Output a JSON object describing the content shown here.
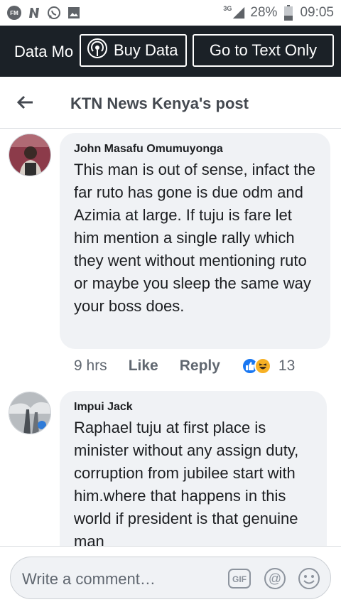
{
  "status_bar": {
    "network": "3G",
    "battery": "28%",
    "time": "09:05",
    "icons": [
      "fm-radio-icon",
      "n-app-icon",
      "whatsapp-icon",
      "gallery-icon",
      "signal-icon",
      "battery-icon"
    ]
  },
  "data_banner": {
    "mode_label": "Data Mo",
    "buy_label": "Buy Data",
    "text_only_label": "Go to Text Only"
  },
  "header": {
    "title": "KTN News Kenya's post"
  },
  "comments": [
    {
      "author": "John Masafu Omumuyonga",
      "text": "This man is out of sense, infact the far ruto has gone is due odm and Azimia at large. If tuju is fare let him mention a single rally which they went without mentioning ruto or maybe you sleep the same way your boss does.",
      "time": "9 hrs",
      "like_label": "Like",
      "reply_label": "Reply",
      "reactions": [
        "like",
        "haha"
      ],
      "reaction_count": "13"
    },
    {
      "author": "Impui Jack",
      "text": "Raphael tuju at first place is minister without any assign duty, corruption from jubilee start with him.where that happens in this world if president is that genuine man"
    }
  ],
  "comment_box": {
    "placeholder": "Write a comment…",
    "gif_label": "GIF"
  },
  "colors": {
    "banner_bg": "#1b2127",
    "bubble_bg": "#f0f2f5",
    "like_blue": "#1877f2",
    "haha_yellow": "#f7b125"
  }
}
